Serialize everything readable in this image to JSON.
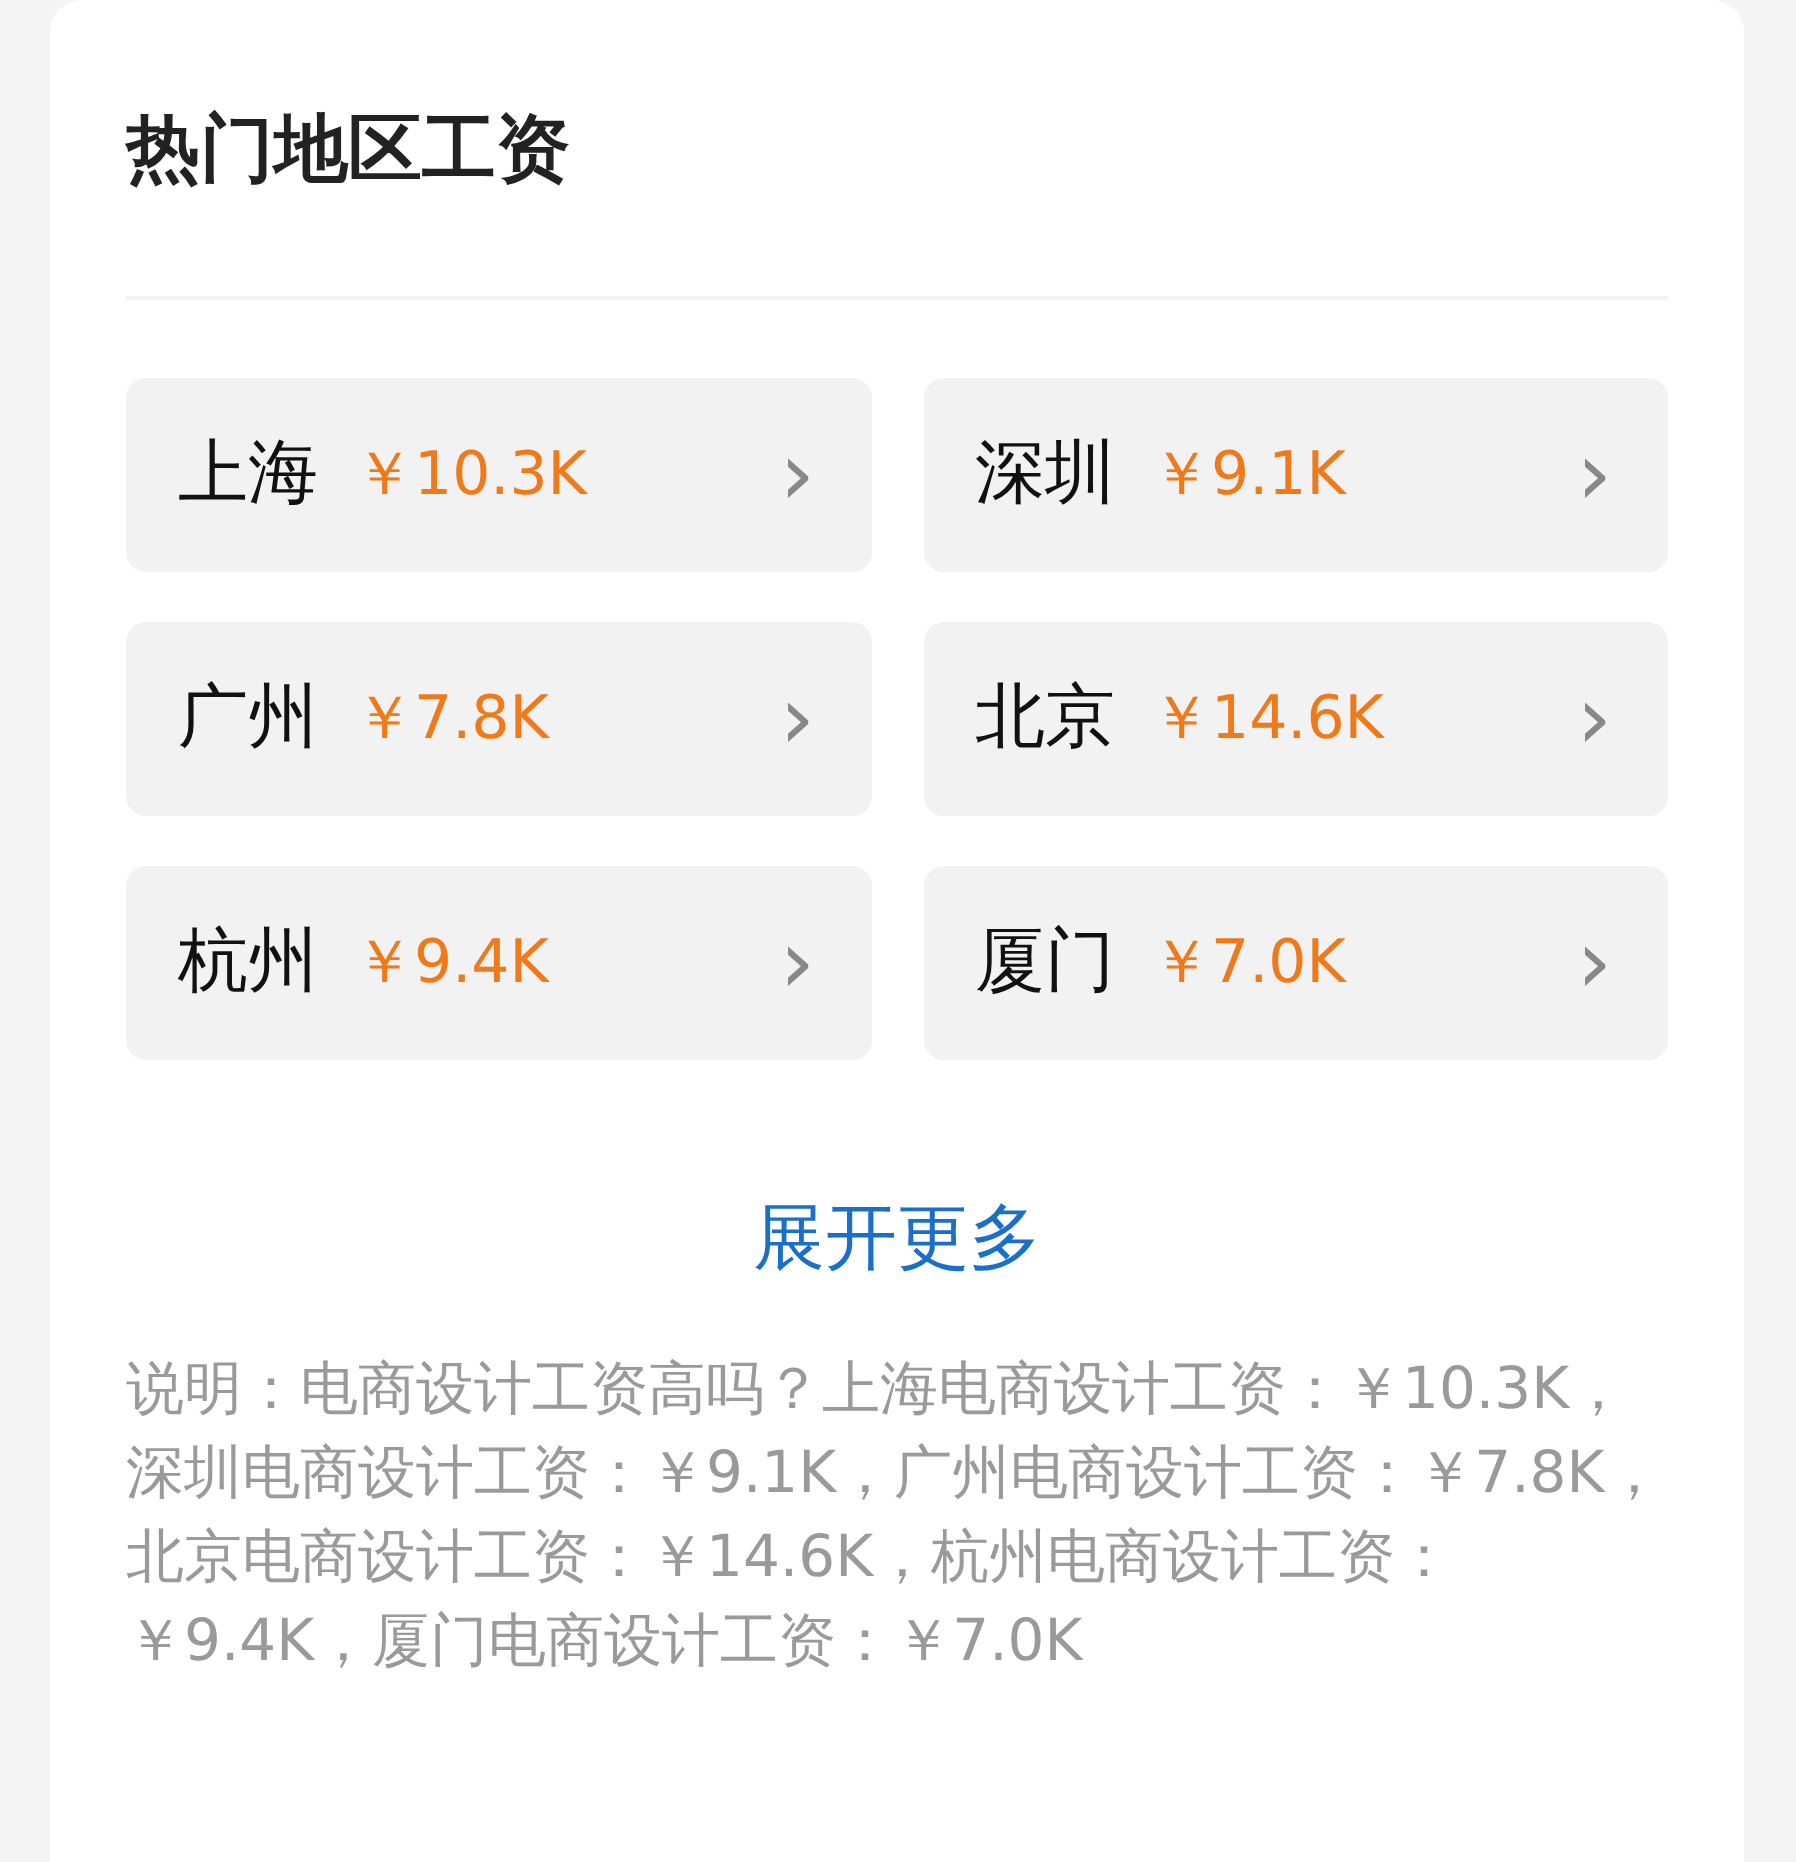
{
  "title": "热门地区工资",
  "regions": [
    {
      "city": "上海",
      "salary": "￥10.3K",
      "arrow": "›"
    },
    {
      "city": "深圳",
      "salary": "￥9.1K",
      "arrow": "›"
    },
    {
      "city": "广州",
      "salary": "￥7.8K",
      "arrow": "›"
    },
    {
      "city": "北京",
      "salary": "￥14.6K",
      "arrow": "›"
    },
    {
      "city": "杭州",
      "salary": "￥9.4K",
      "arrow": "›"
    },
    {
      "city": "厦门",
      "salary": "￥7.0K",
      "arrow": "›"
    }
  ],
  "more_link": "展开更多",
  "description": "说明：电商设计工资高吗？上海电商设计工资：￥10.3K，深圳电商设计工资：￥9.1K，广州电商设计工资：￥7.8K，北京电商设计工资：￥14.6K，杭州电商设计工资：￥9.4K，厦门电商设计工资：￥7.0K"
}
